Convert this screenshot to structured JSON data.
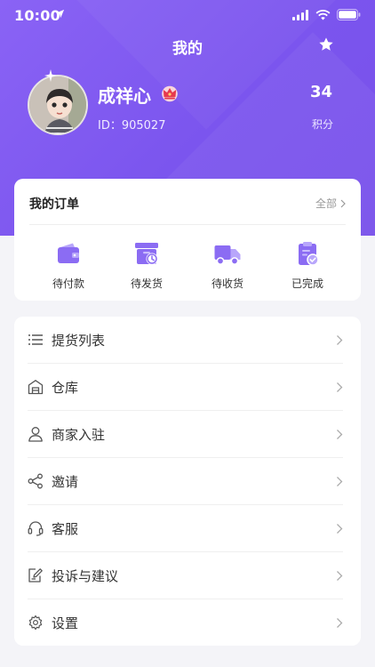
{
  "status": {
    "time": "10:00"
  },
  "header": {
    "title": "我的"
  },
  "profile": {
    "name": "成祥心",
    "id_text": "ID：905027",
    "points_value": "34",
    "points_label": "积分"
  },
  "orders": {
    "title": "我的订单",
    "all_label": "全部",
    "items": [
      {
        "label": "待付款",
        "icon": "wallet-icon"
      },
      {
        "label": "待发货",
        "icon": "package-clock-icon"
      },
      {
        "label": "待收货",
        "icon": "truck-icon"
      },
      {
        "label": "已完成",
        "icon": "clipboard-check-icon"
      }
    ]
  },
  "menu": {
    "items": [
      {
        "label": "提货列表",
        "icon": "list-icon"
      },
      {
        "label": "仓库",
        "icon": "warehouse-icon"
      },
      {
        "label": "商家入驻",
        "icon": "user-icon"
      },
      {
        "label": "邀请",
        "icon": "share-icon"
      },
      {
        "label": "客服",
        "icon": "headset-icon"
      },
      {
        "label": "投诉与建议",
        "icon": "edit-icon"
      },
      {
        "label": "设置",
        "icon": "gear-icon"
      }
    ]
  },
  "colors": {
    "accent": "#7b55ee",
    "icon_purple": "#8b6cf3"
  }
}
